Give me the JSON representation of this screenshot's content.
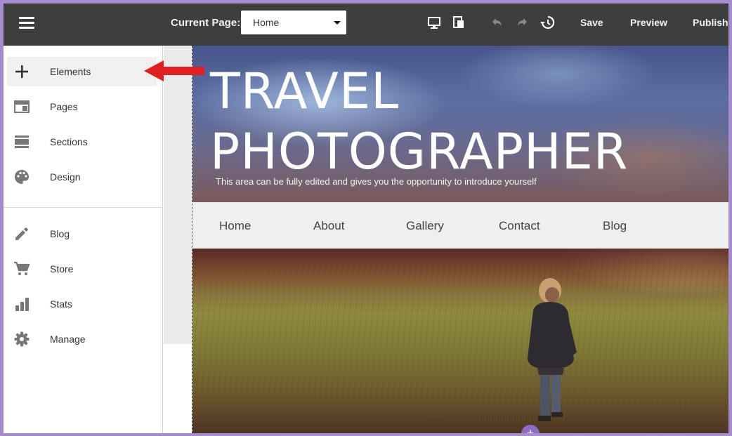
{
  "topbar": {
    "current_page_label": "Current Page:",
    "current_page_value": "Home",
    "save_label": "Save",
    "preview_label": "Preview",
    "publish_label": "Publish"
  },
  "sidebar": {
    "items": [
      {
        "label": "Elements",
        "icon": "plus-icon"
      },
      {
        "label": "Pages",
        "icon": "pages-icon"
      },
      {
        "label": "Sections",
        "icon": "sections-icon"
      },
      {
        "label": "Design",
        "icon": "palette-icon"
      },
      {
        "label": "Blog",
        "icon": "pencil-icon"
      },
      {
        "label": "Store",
        "icon": "cart-icon"
      },
      {
        "label": "Stats",
        "icon": "bar-chart-icon"
      },
      {
        "label": "Manage",
        "icon": "gear-icon"
      }
    ]
  },
  "hero": {
    "title_line1": "TRAVEL",
    "title_line2": "PHOTOGRAPHER",
    "subtitle": "This area can be fully edited and gives you the opportunity to introduce yourself"
  },
  "site_nav": [
    "Home",
    "About",
    "Gallery",
    "Contact",
    "Blog"
  ],
  "colors": {
    "topbar": "#3e3e3e",
    "frame_border": "#a58ccc",
    "arrow": "#e02020",
    "add_button": "#8e6cc4"
  }
}
